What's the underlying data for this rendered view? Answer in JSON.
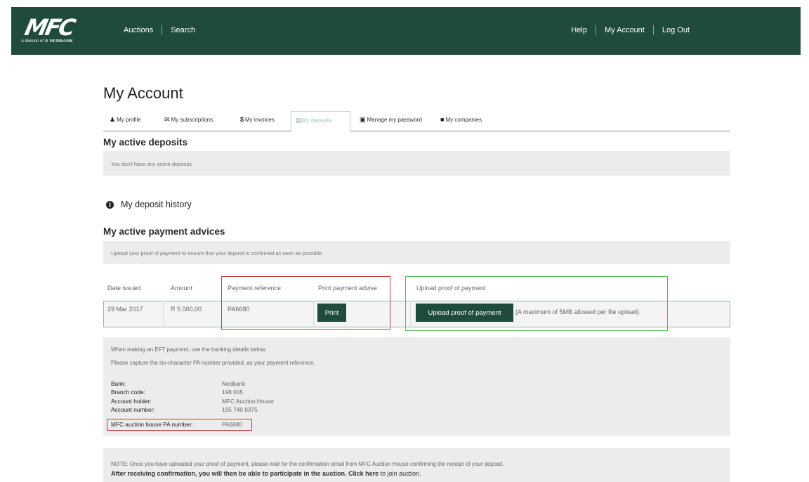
{
  "header": {
    "logo_text": "MFC",
    "logo_sub_prefix": "A division of",
    "logo_sub_brand": "NEDBANK",
    "nav_left": [
      "Auctions",
      "Search"
    ],
    "nav_right": [
      "Help",
      "My Account",
      "Log Out"
    ]
  },
  "page_title": "My Account",
  "tabs": [
    {
      "label": "My profile",
      "icon": "user-icon",
      "glyph": "👤"
    },
    {
      "label": "My subscriptions",
      "icon": "envelope-icon",
      "glyph": "✉"
    },
    {
      "label": "My invoices",
      "icon": "dollar-icon",
      "glyph": "$"
    },
    {
      "label": "My deposits",
      "icon": "money-icon",
      "glyph": "▤",
      "active": true
    },
    {
      "label": "Manage my password",
      "icon": "lock-icon",
      "glyph": "🔒"
    },
    {
      "label": "My companies",
      "icon": "briefcase-icon",
      "glyph": "💼"
    }
  ],
  "active_deposits": {
    "heading": "My active deposits",
    "message": "You don't have any active deposits"
  },
  "deposit_history": {
    "label": "My deposit history"
  },
  "payment_advices": {
    "heading": "My active payment advices",
    "message": "Upload your proof of payment to ensure that your deposit is confirmed as soon as possible.",
    "columns": [
      "Date issued",
      "Amount",
      "Payment reference",
      "Print payment advise",
      "Upload proof of payment"
    ],
    "row": {
      "date": "29 Mar 2017",
      "amount": "R 5 000,00",
      "reference": "PA6680",
      "print_label": "Print",
      "upload_label": "Upload proof of payment",
      "upload_note": "(A maximum of 5MB allowed per file upload)"
    }
  },
  "banking": {
    "intro1": "When making an EFT payment, use the banking details below.",
    "intro2": "Please capture the six-character PA number provided, as your payment reference.",
    "rows": [
      {
        "label": "Bank:",
        "value": "Nedbank"
      },
      {
        "label": "Branch code:",
        "value": "198 005"
      },
      {
        "label": "Account holder:",
        "value": "MFC Auction House"
      },
      {
        "label": "Account number:",
        "value": "195 740 8375"
      },
      {
        "label": "MFC auction house PA number:",
        "value": "PA6680"
      }
    ]
  },
  "note": {
    "line1": "NOTE: Once you have uploaded your proof of payment, please wait for the confirmation email from MFC Auction House confirming the receipt of your deposit.",
    "line2_bold": "After receiving confirmation, you will then be able to participate in the auction.",
    "link": "Click here",
    "line2_tail": "to join auction."
  },
  "colors": {
    "brand_green": "#1f4b3a",
    "highlight_red": "#c8383c",
    "highlight_green": "#5cb85c"
  }
}
